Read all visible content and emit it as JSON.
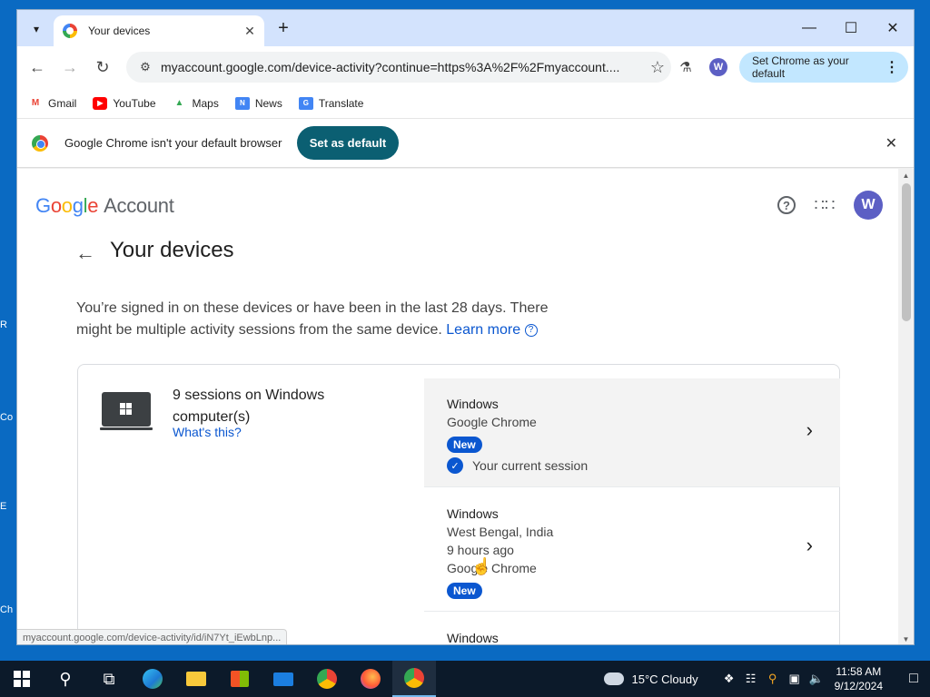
{
  "browser": {
    "tab_title": "Your devices",
    "url": "myaccount.google.com/device-activity?continue=https%3A%2F%2Fmyaccount....",
    "set_default_chip": "Set Chrome as your default",
    "profile_initial": "W",
    "bookmarks": [
      {
        "label": "Gmail",
        "icon": "gmail-icon",
        "color": "#ea4335"
      },
      {
        "label": "YouTube",
        "icon": "youtube-icon",
        "color": "#ff0000"
      },
      {
        "label": "Maps",
        "icon": "maps-icon",
        "color": "#34a853"
      },
      {
        "label": "News",
        "icon": "news-icon",
        "color": "#4285f4"
      },
      {
        "label": "Translate",
        "icon": "translate-icon",
        "color": "#4285f4"
      }
    ],
    "infobar": {
      "message": "Google Chrome isn't your default browser",
      "button": "Set as default"
    },
    "status_url": "myaccount.google.com/device-activity/id/iN7Yt_iEwbLnp..."
  },
  "page": {
    "logo_google": "Google",
    "logo_account": "Account",
    "avatar_initial": "W",
    "title": "Your devices",
    "description": "You’re signed in on these devices or have been in the last 28 days. There might be multiple activity sessions from the same device.",
    "learn_more": "Learn more",
    "device_group": {
      "title": "9 sessions on Windows computer(s)",
      "whats_this": "What's this?",
      "sessions": [
        {
          "device": "Windows",
          "lines": [
            "Google Chrome"
          ],
          "badge": "New",
          "current": "Your current session"
        },
        {
          "device": "Windows",
          "lines": [
            "West Bengal, India",
            "9 hours ago",
            "Google Chrome"
          ],
          "badge": "New"
        },
        {
          "device": "Windows"
        }
      ]
    }
  },
  "taskbar": {
    "weather": "15°C  Cloudy",
    "time": "11:58 AM",
    "date": "9/12/2024",
    "accent": "#0b57d0"
  }
}
